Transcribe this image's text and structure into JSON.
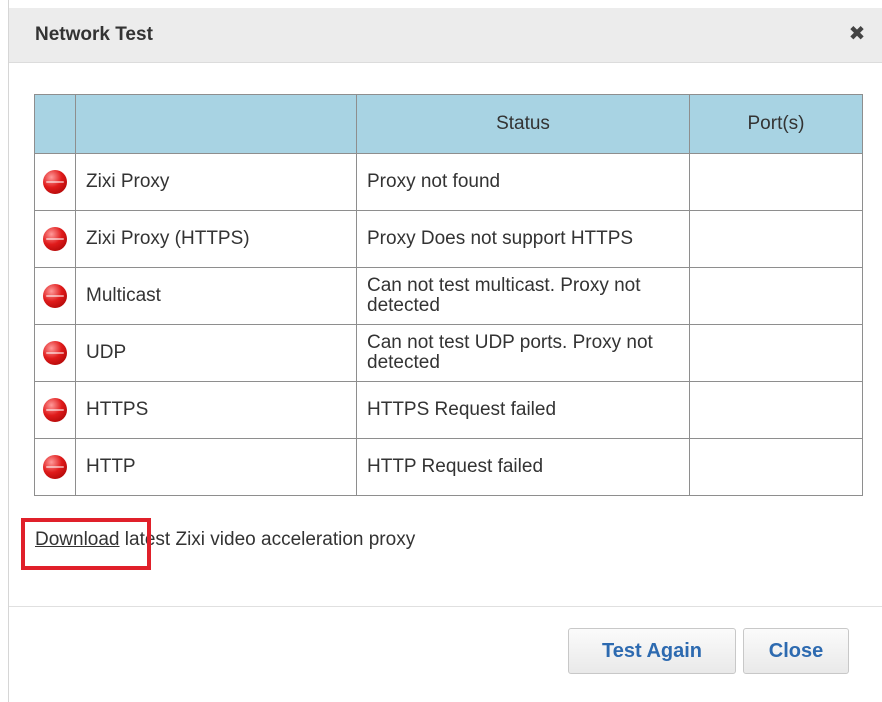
{
  "dialog": {
    "title": "Network Test",
    "close_icon": "close-icon"
  },
  "table": {
    "headers": [
      "",
      "",
      "Status",
      "Port(s)"
    ],
    "rows": [
      {
        "status_color": "#d40000",
        "name": "Zixi Proxy",
        "status": "Proxy not found",
        "ports": ""
      },
      {
        "status_color": "#d40000",
        "name": "Zixi Proxy (HTTPS)",
        "status": "Proxy Does not support HTTPS",
        "ports": ""
      },
      {
        "status_color": "#d40000",
        "name": "Multicast",
        "status": "Can not test multicast. Proxy not detected",
        "ports": ""
      },
      {
        "status_color": "#d40000",
        "name": "UDP",
        "status": "Can not test UDP ports. Proxy not detected",
        "ports": ""
      },
      {
        "status_color": "#d40000",
        "name": "HTTPS",
        "status": "HTTPS Request failed",
        "ports": ""
      },
      {
        "status_color": "#d40000",
        "name": "HTTP",
        "status": "HTTP Request failed",
        "ports": ""
      }
    ]
  },
  "download": {
    "link_label": "Download",
    "text": "latest Zixi video acceleration proxy"
  },
  "buttons": {
    "test_again": "Test Again",
    "close": "Close"
  },
  "colors": {
    "header_bg": "#a8d3e3",
    "button_text": "#2d6ab0",
    "highlight": "#e0202a"
  }
}
